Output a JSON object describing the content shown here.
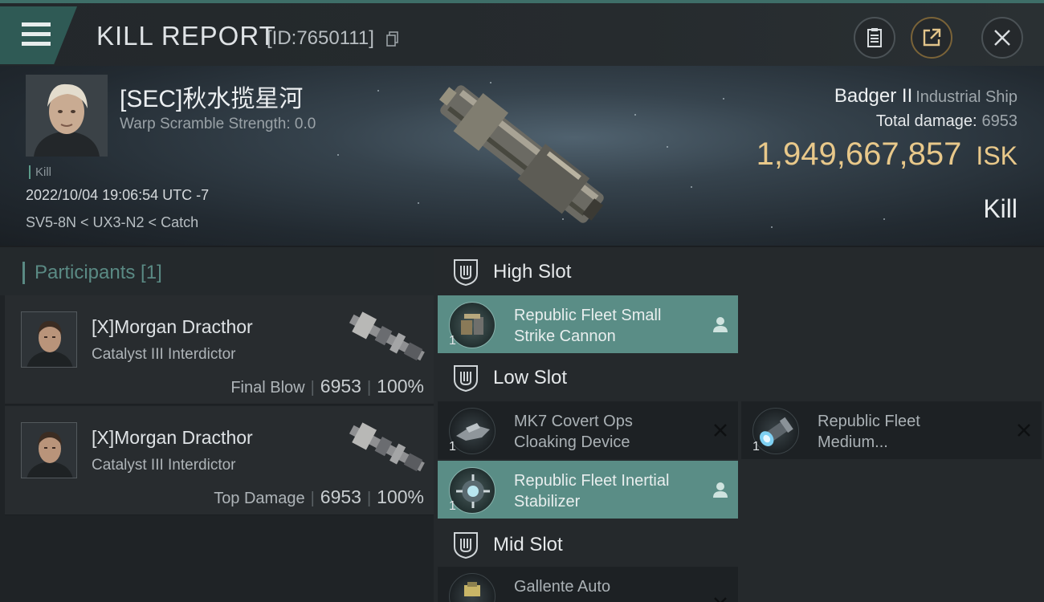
{
  "header": {
    "title": "KILL REPORT",
    "id_text": "[ID:7650111]"
  },
  "victim": {
    "pilot_name": "[SEC]秋水揽星河",
    "warp_scramble": "Warp Scramble Strength: 0.0",
    "kill_tag": "Kill",
    "date": "2022/10/04 19:06:54 UTC -7",
    "location": "SV5-8N < UX3-N2 < Catch",
    "ship_name": "Badger II",
    "ship_class": "Industrial Ship",
    "total_damage_label": "Total damage:",
    "total_damage_value": "6953",
    "isk_value": "1,949,667,857",
    "isk_unit": "ISK",
    "result": "Kill"
  },
  "participants": {
    "title": "Participants [1]",
    "rows": [
      {
        "name": "[X]Morgan Dracthor",
        "ship": "Catalyst III Interdictor",
        "role": "Final Blow",
        "damage": "6953",
        "percent": "100%"
      },
      {
        "name": "[X]Morgan Dracthor",
        "ship": "Catalyst III Interdictor",
        "role": "Top Damage",
        "damage": "6953",
        "percent": "100%"
      }
    ]
  },
  "slots": {
    "high": {
      "title": "High Slot",
      "modules": [
        {
          "name": "Republic Fleet Small Strike Cannon",
          "qty": "1",
          "state": "fitted"
        }
      ]
    },
    "low": {
      "title": "Low Slot",
      "modules": [
        {
          "name": "MK7 Covert Ops Cloaking Device",
          "qty": "1",
          "state": "destroyed"
        },
        {
          "name": "Republic Fleet Medium...",
          "qty": "1",
          "state": "destroyed"
        },
        {
          "name": "Republic Fleet Inertial Stabilizer",
          "qty": "1",
          "state": "fitted"
        }
      ]
    },
    "mid": {
      "title": "Mid Slot",
      "modules": [
        {
          "name": "Gallente Auto",
          "qty": "",
          "state": "destroyed"
        }
      ]
    }
  },
  "colors": {
    "accent": "#5a8d86",
    "isk": "#e8c88a",
    "header_strip": "#3e6e68"
  },
  "icons": [
    "menu-icon",
    "copy-icon",
    "clipboard-icon",
    "share-icon",
    "close-icon",
    "slot-icon",
    "pilot-icon",
    "destroyed-x-icon"
  ]
}
